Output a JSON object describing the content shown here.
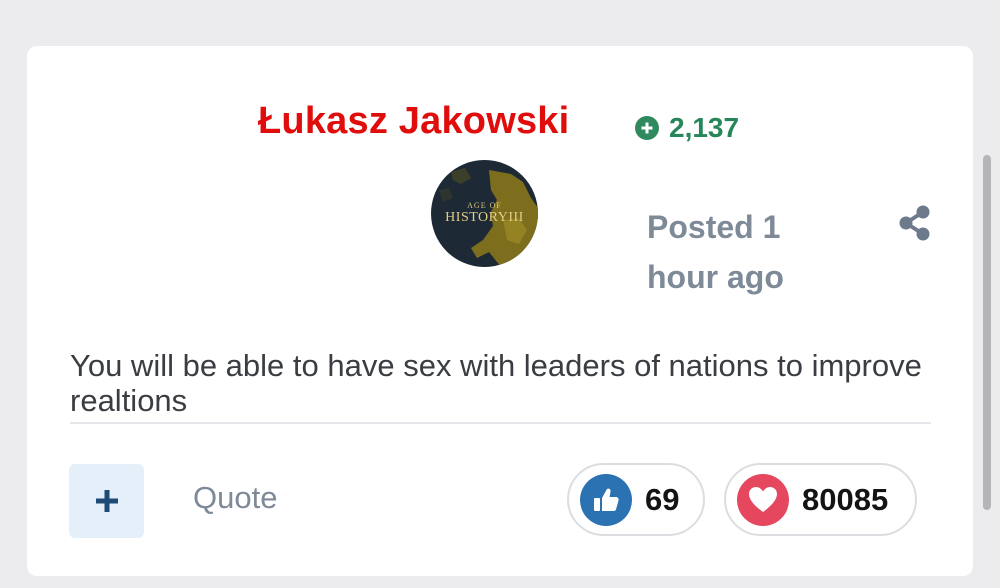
{
  "post": {
    "author": "Łukasz Jakowski",
    "reputation": "2,137",
    "avatar": {
      "line1": "AGE OF",
      "line2": "HISTORYIII"
    },
    "posted": "Posted 1 hour ago",
    "body": "You will be able to have sex with leaders of nations to improve realtions"
  },
  "actions": {
    "quote_label": "Quote"
  },
  "reactions": {
    "like_count": "69",
    "love_count": "80085"
  },
  "colors": {
    "author": "#e00d0d",
    "reputation": "#27855a",
    "like": "#2a72b2",
    "love": "#e5475f",
    "muted": "#7e8a98"
  }
}
